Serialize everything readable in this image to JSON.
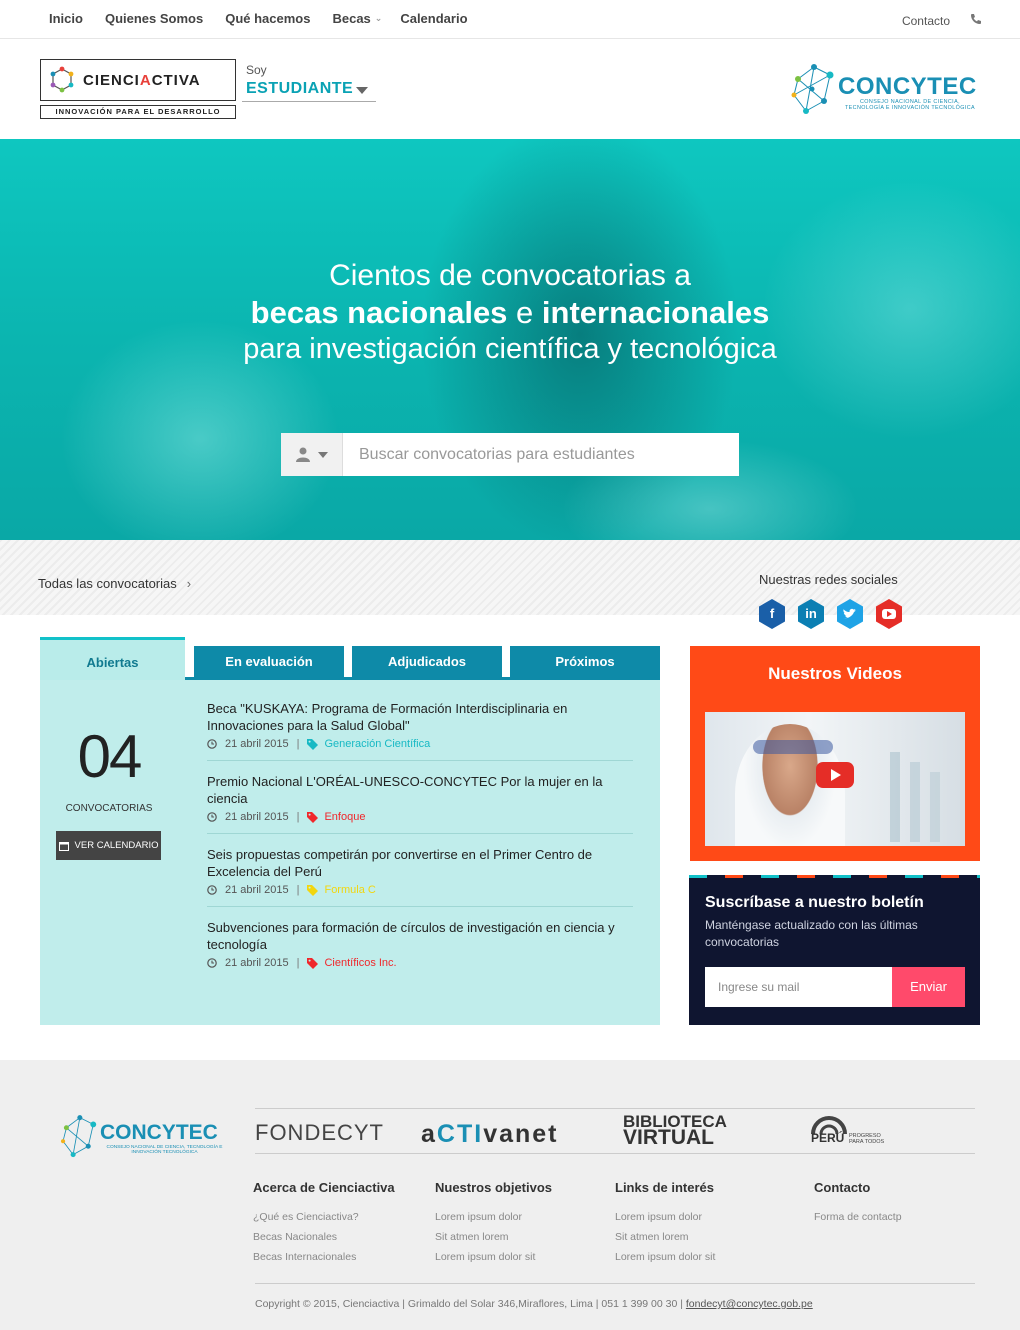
{
  "topnav": {
    "items": [
      "Inicio",
      "Quienes Somos",
      "Qué hacemos",
      "Becas",
      "Calendario"
    ],
    "contact": "Contacto"
  },
  "brand": {
    "name_left": "CIENCI",
    "name_accent": "A",
    "name_right": "CTIVA",
    "tagline": "INNOVACIÓN PARA EL DESARROLLO"
  },
  "profile": {
    "label": "Soy",
    "value": "ESTUDIANTE"
  },
  "concytec": {
    "name": "CONCYTEC",
    "subtitle": "CONSEJO NACIONAL DE CIENCIA, TECNOLOGÍA E INNOVACIÓN TECNOLÓGICA"
  },
  "hero": {
    "line1": "Cientos de convocatorias a",
    "line2_a": "becas nacionales",
    "line2_b": " e ",
    "line2_c": "internacionales",
    "line3": "para investigación científica y tecnológica",
    "search_placeholder": "Buscar convocatorias para estudiantes"
  },
  "strip": {
    "all_link": "Todas las convocatorias",
    "social_label": "Nuestras redes sociales"
  },
  "tabs": [
    "Abiertas",
    "En evaluación",
    "Adjudicados",
    "Próximos"
  ],
  "summary": {
    "count": "04",
    "label": "CONVOCATORIAS",
    "button": "VER CALENDARIO"
  },
  "items": [
    {
      "title": "Beca \"KUSKAYA: Programa de Formación Interdisciplinaria en Innovaciones para la Salud Global\"",
      "date": "21 abril 2015",
      "tag": "Generación Científica",
      "tag_color": "#17b9c4"
    },
    {
      "title": "Premio Nacional L'ORÉAL-UNESCO-CONCYTEC Por la mujer en la ciencia",
      "date": "21 abril 2015",
      "tag": "Enfoque",
      "tag_color": "#f0272b"
    },
    {
      "title": "Seis propuestas competirán por convertirse en el Primer Centro de Excelencia del Perú",
      "date": "21 abril 2015",
      "tag": "Formula C",
      "tag_color": "#f2d60f"
    },
    {
      "title": "Subvenciones para formación de círculos de investigación en ciencia y tecnología",
      "date": "21 abril 2015",
      "tag": "Científicos Inc.",
      "tag_color": "#f0272b"
    }
  ],
  "videos": {
    "title": "Nuestros Videos"
  },
  "newsletter": {
    "title": "Suscríbase a nuestro boletín",
    "text": "Manténgase actualizado con las últimas convocatorias",
    "placeholder": "Ingrese su mail",
    "button": "Enviar"
  },
  "footer": {
    "partners": {
      "fondecyt": "FONDECYT",
      "activanet_a": "a",
      "activanet_b": "CTI",
      "activanet_c": "vanet",
      "biblioteca_1": "BIBLIOTECA",
      "biblioteca_2": "VIRTUAL",
      "peru": "PERÚ",
      "peru_sub": "PROGRESO PARA TODOS"
    },
    "columns": [
      {
        "title": "Acerca de Cienciactiva",
        "links": [
          "¿Qué es Cienciactiva?",
          "Becas Nacionales",
          "Becas Internacionales"
        ]
      },
      {
        "title": "Nuestros objetivos",
        "links": [
          "Lorem ipsum dolor",
          "Sit atmen lorem",
          "Lorem ipsum dolor sit"
        ]
      },
      {
        "title": "Links de interés",
        "links": [
          "Lorem ipsum dolor",
          "Sit atmen lorem",
          "Lorem ipsum dolor sit"
        ]
      },
      {
        "title": "Contacto",
        "links": [
          "Forma de contactp"
        ]
      }
    ],
    "copyright": "Copyright © 2015, Cienciactiva | Grimaldo del Solar 346,Miraflores, Lima | 051 1 399 00 30 | ",
    "email": "fondecyt@concytec.gob.pe"
  },
  "colors": {
    "accent": "#0aa2b4",
    "tab": "#0e8aa8",
    "orange": "#ff4a17",
    "navy": "#0f1530",
    "pink": "#ff4a6b"
  }
}
